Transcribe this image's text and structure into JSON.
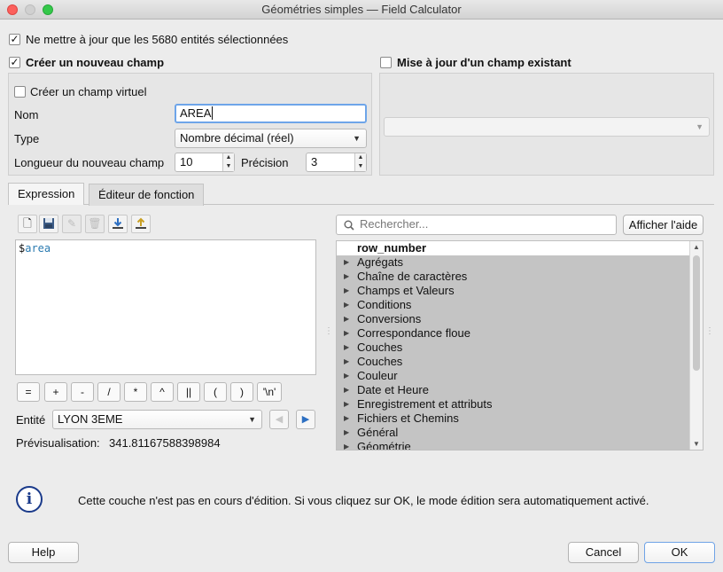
{
  "window": {
    "title": "Géométries simples — Field Calculator"
  },
  "only_selected": {
    "label": "Ne mettre à jour que les 5680 entités sélectionnées",
    "checked": true
  },
  "create_field": {
    "label": "Créer un nouveau champ",
    "checked": true,
    "virtual_label": "Créer un champ virtuel",
    "name_label": "Nom",
    "name_value": "AREA",
    "type_label": "Type",
    "type_value": "Nombre décimal (réel)",
    "length_label": "Longueur du nouveau champ",
    "length_value": "10",
    "precision_label": "Précision",
    "precision_value": "3"
  },
  "update_field": {
    "label": "Mise à jour d'un champ existant",
    "checked": false,
    "combo_value": ""
  },
  "tabs": [
    {
      "label": "Expression",
      "active": true
    },
    {
      "label": "Éditeur de fonction",
      "active": false
    }
  ],
  "toolbar_icons": [
    "new-file-icon",
    "save-icon",
    "edit-icon",
    "delete-icon",
    "import-icon",
    "export-icon"
  ],
  "expression": {
    "prefix": "$",
    "keyword": "area"
  },
  "operators": [
    "=",
    "+",
    "-",
    "/",
    "*",
    "^",
    "||",
    "(",
    ")",
    "'\\n'"
  ],
  "entity": {
    "label": "Entité",
    "value": "LYON 3EME"
  },
  "preview": {
    "label": "Prévisualisation:",
    "value": "341.81167588398984"
  },
  "search": {
    "placeholder": "Rechercher...",
    "help_button": "Afficher l'aide"
  },
  "functions": {
    "header": "row_number",
    "groups": [
      "Agrégats",
      "Chaîne de caractères",
      "Champs et Valeurs",
      "Conditions",
      "Conversions",
      "Correspondance floue",
      "Couches",
      "Couches",
      "Couleur",
      "Date et Heure",
      "Enregistrement et attributs",
      "Fichiers et Chemins",
      "Général",
      "Géométrie"
    ]
  },
  "message": "Cette couche n'est pas en cours d'édition. Si vous cliquez sur OK, le mode édition sera automatiquement activé.",
  "buttons": {
    "help": "Help",
    "cancel": "Cancel",
    "ok": "OK"
  },
  "colors": {
    "keyword": "#2a7ab0",
    "focus": "#6ea5e9",
    "group_row": "#c4c4c4"
  }
}
